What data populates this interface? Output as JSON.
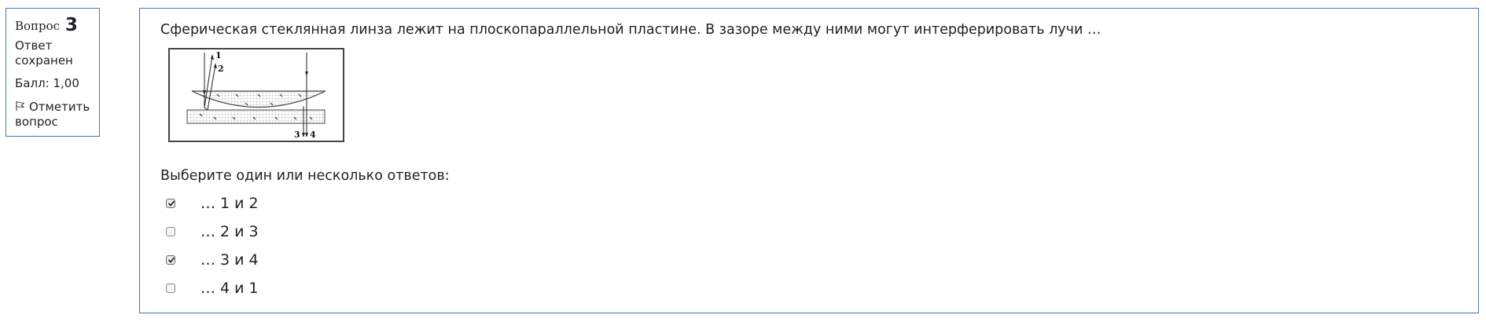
{
  "question_info": {
    "label": "Вопрос",
    "number": "3",
    "state": "Ответ сохранен",
    "grade": "Балл: 1,00",
    "flag_label": "Отметить вопрос",
    "flag_icon": "flag-icon"
  },
  "question": {
    "text": "Сферическая стеклянная линза лежит на плоскопараллельной пластине. В зазоре между ними могут интерферировать лучи …",
    "figure_labels": [
      "1",
      "2",
      "3",
      "4"
    ],
    "prompt": "Выберите один или несколько ответов:",
    "answers": [
      {
        "label": "… 1 и 2",
        "checked": true
      },
      {
        "label": "… 2 и 3",
        "checked": false
      },
      {
        "label": "… 3 и 4",
        "checked": true
      },
      {
        "label": "… 4 и 1",
        "checked": false
      }
    ]
  },
  "colors": {
    "border": "#4a76a8",
    "text": "#1d2125"
  }
}
